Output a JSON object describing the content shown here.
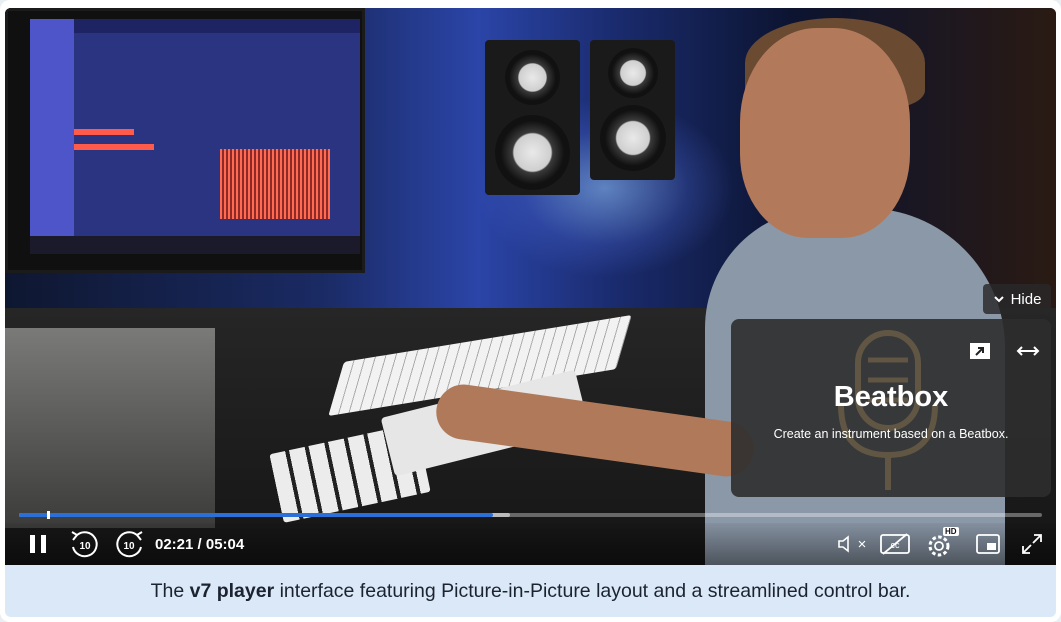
{
  "player": {
    "current_time": "02:21",
    "duration": "05:04",
    "time_display": "02:21 / 05:04",
    "progress": 0.463,
    "buffered": 0.48,
    "skip_back_seconds": "10",
    "skip_forward_seconds": "10",
    "hide_label": "Hide",
    "quality_badge": "HD",
    "mute_suffix": "×"
  },
  "pip_panel": {
    "title": "Beatbox",
    "description": "Create an instrument based on a Beatbox."
  },
  "caption": {
    "prefix": "The",
    "emphasis": "v7 player",
    "suffix": "interface featuring Picture-in-Picture layout and a streamlined control bar."
  },
  "colors": {
    "progress_fill": "#2b6fd9",
    "caption_bg": "#dbe8f8",
    "pip_bg": "#2d2d2d"
  },
  "icons": [
    "pause-icon",
    "skip-back-icon",
    "skip-forward-icon",
    "volume-muted-icon",
    "captions-off-icon",
    "settings-icon",
    "pip-icon",
    "fullscreen-icon",
    "chevron-down-icon",
    "open-external-icon",
    "swap-icon",
    "microphone-icon"
  ]
}
